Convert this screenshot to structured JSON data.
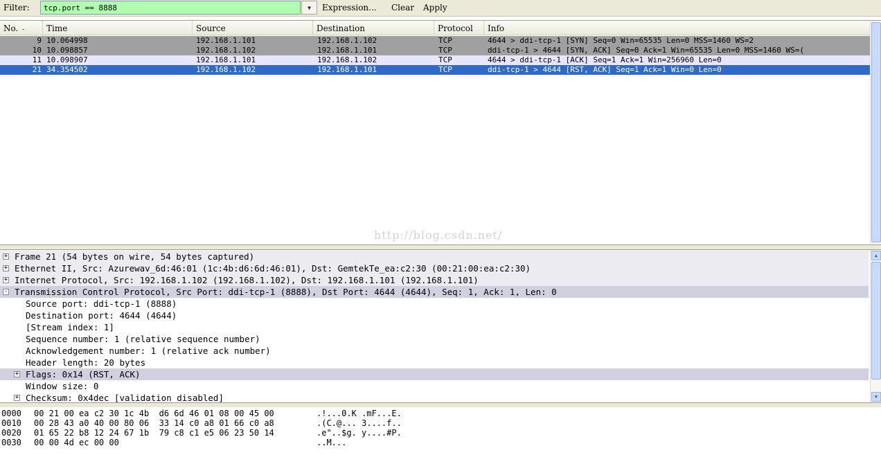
{
  "filter": {
    "label": "Filter:",
    "value": "tcp.port == 8888",
    "buttons": [
      "Expression...",
      "Clear",
      "Apply"
    ]
  },
  "packet_list": {
    "columns": [
      "No. ",
      "Time",
      "Source",
      "Destination",
      "Protocol",
      "Info"
    ],
    "sort_indicator": "-",
    "rows": [
      {
        "no": "9",
        "time": "10.064998",
        "source": "192.168.1.101",
        "destination": "192.168.1.102",
        "protocol": "TCP",
        "info": "4644 > ddi-tcp-1 [SYN] Seq=0 Win=65535 Len=0 MSS=1460 WS=2",
        "style": "gray"
      },
      {
        "no": "10",
        "time": "10.098857",
        "source": "192.168.1.102",
        "destination": "192.168.1.101",
        "protocol": "TCP",
        "info": "ddi-tcp-1 > 4644 [SYN, ACK] Seq=0 Ack=1 Win=65535 Len=0 MSS=1460 WS=(",
        "style": "gray"
      },
      {
        "no": "11",
        "time": "10.098907",
        "source": "192.168.1.101",
        "destination": "192.168.1.102",
        "protocol": "TCP",
        "info": "4644 > ddi-tcp-1 [ACK] Seq=1 Ack=1 Win=256960 Len=0",
        "style": "lilac"
      },
      {
        "no": "21",
        "time": "34.354502",
        "source": "192.168.1.102",
        "destination": "192.168.1.101",
        "protocol": "TCP",
        "info": "ddi-tcp-1 > 4644 [RST, ACK] Seq=1 Ack=1 Win=0 Len=0",
        "style": "selected"
      }
    ],
    "watermark": "http://blog.csdn.net/"
  },
  "details": {
    "rows": [
      {
        "text": "Frame 21 (54 bytes on wire, 54 bytes captured)",
        "expander": "+",
        "level": 0,
        "style": "top"
      },
      {
        "text": "Ethernet II, Src: Azurewav_6d:46:01 (1c:4b:d6:6d:46:01), Dst: GemtekTe_ea:c2:30 (00:21:00:ea:c2:30)",
        "expander": "+",
        "level": 0,
        "style": "top"
      },
      {
        "text": "Internet Protocol, Src: 192.168.1.102 (192.168.1.102), Dst: 192.168.1.101 (192.168.1.101)",
        "expander": "+",
        "level": 0,
        "style": "top"
      },
      {
        "text": "Transmission Control Protocol, Src Port: ddi-tcp-1 (8888), Dst Port: 4644 (4644), Seq: 1, Ack: 1, Len: 0",
        "expander": "-",
        "level": 0,
        "style": "sel"
      },
      {
        "text": "Source port: ddi-tcp-1 (8888)",
        "expander": "",
        "level": 1,
        "style": ""
      },
      {
        "text": "Destination port: 4644 (4644)",
        "expander": "",
        "level": 1,
        "style": ""
      },
      {
        "text": "[Stream index: 1]",
        "expander": "",
        "level": 1,
        "style": ""
      },
      {
        "text": "Sequence number: 1    (relative sequence number)",
        "expander": "",
        "level": 1,
        "style": ""
      },
      {
        "text": "Acknowledgement number: 1    (relative ack number)",
        "expander": "",
        "level": 1,
        "style": ""
      },
      {
        "text": "Header length: 20 bytes",
        "expander": "",
        "level": 1,
        "style": ""
      },
      {
        "text": "Flags: 0x14 (RST, ACK)",
        "expander": "+",
        "level": 1,
        "style": "sel"
      },
      {
        "text": "Window size: 0",
        "expander": "",
        "level": 1,
        "style": ""
      },
      {
        "text": "Checksum: 0x4dec [validation disabled]",
        "expander": "+",
        "level": 1,
        "style": ""
      }
    ]
  },
  "hex": {
    "rows": [
      {
        "offset": "0000",
        "bytes": "00 21 00 ea c2 30 1c 4b  d6 6d 46 01 08 00 45 00",
        "ascii": ".!...0.K .mF...E."
      },
      {
        "offset": "0010",
        "bytes": "00 28 43 a0 40 00 80 06  33 14 c0 a8 01 66 c0 a8",
        "ascii": ".(C.@... 3....f.."
      },
      {
        "offset": "0020",
        "bytes": "01 65 22 b8 12 24 67 1b  79 c8 c1 e5 06 23 50 14",
        "ascii": ".e\"..$g. y....#P."
      },
      {
        "offset": "0030",
        "bytes": "00 00 4d ec 00 00",
        "ascii": "..M..."
      }
    ]
  }
}
